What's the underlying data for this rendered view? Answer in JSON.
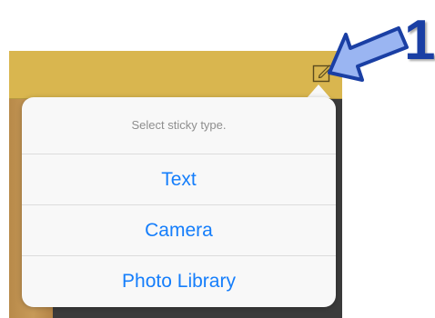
{
  "popover": {
    "title": "Select sticky type.",
    "options": [
      {
        "label": "Text"
      },
      {
        "label": "Camera"
      },
      {
        "label": "Photo Library"
      }
    ]
  },
  "annotation": {
    "number": "1"
  },
  "icons": {
    "edit": "compose-icon",
    "callout": "arrow-pointer-icon"
  },
  "colors": {
    "toolbar": "#d9b64f",
    "accent": "#157efb",
    "callout": "#1a3fa4",
    "callout_fill": "#9ab5f2"
  }
}
